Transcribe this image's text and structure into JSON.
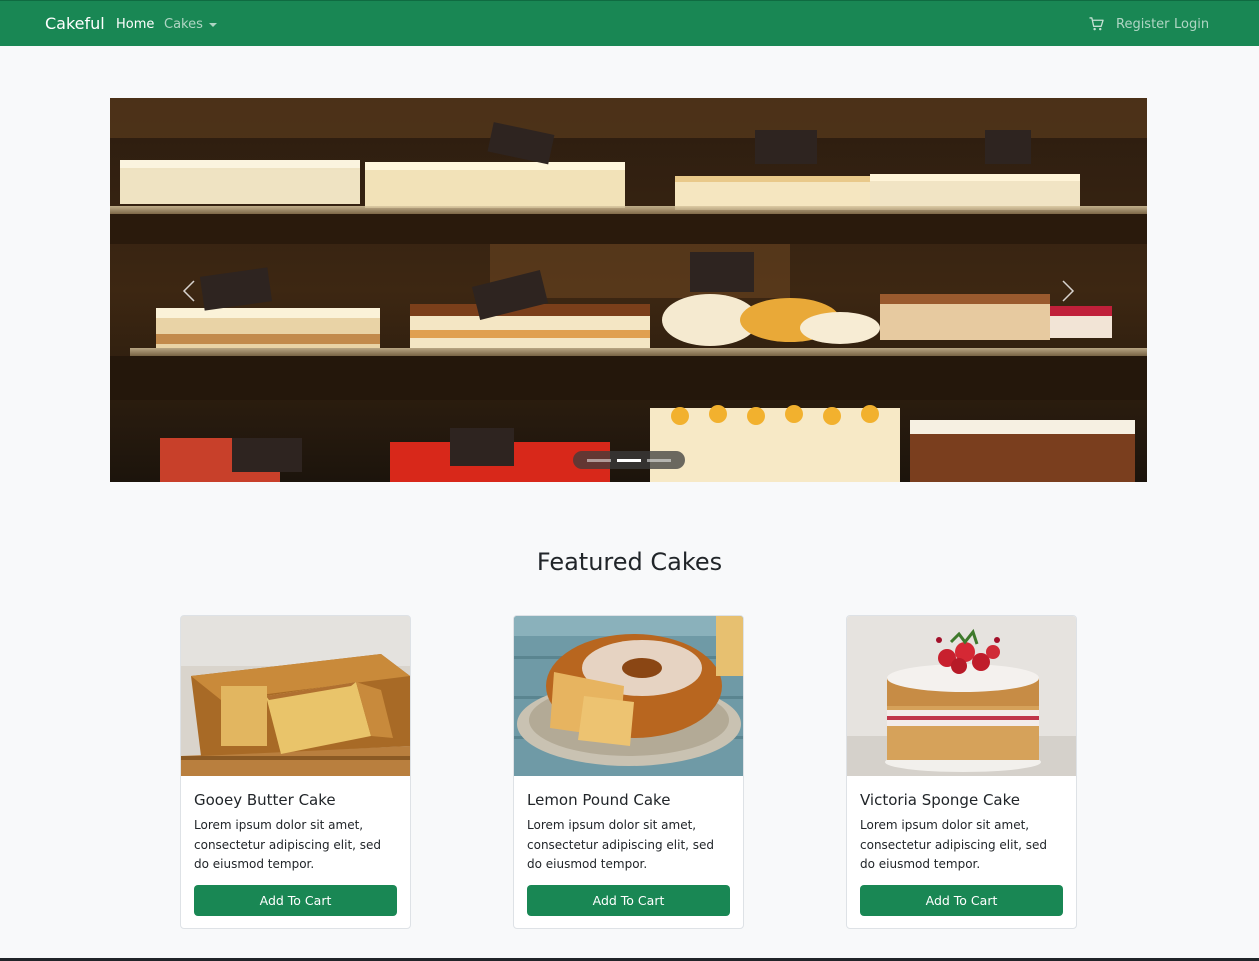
{
  "navbar": {
    "brand": "Cakeful",
    "home": "Home",
    "cakes": "Cakes",
    "register": "Register",
    "login": "Login",
    "cart_icon": "cart-icon",
    "color": "#198754"
  },
  "carousel": {
    "slide_count": 3,
    "active_index": 1
  },
  "featured": {
    "title": "Featured Cakes",
    "cards": [
      {
        "title": "Gooey Butter Cake",
        "text": "Lorem ipsum dolor sit amet, consectetur adipiscing elit, sed do eiusmod tempor.",
        "button": "Add To Cart"
      },
      {
        "title": "Lemon Pound Cake",
        "text": "Lorem ipsum dolor sit amet, consectetur adipiscing elit, sed do eiusmod tempor.",
        "button": "Add To Cart"
      },
      {
        "title": "Victoria Sponge Cake",
        "text": "Lorem ipsum dolor sit amet, consectetur adipiscing elit, sed do eiusmod tempor.",
        "button": "Add To Cart"
      }
    ]
  }
}
